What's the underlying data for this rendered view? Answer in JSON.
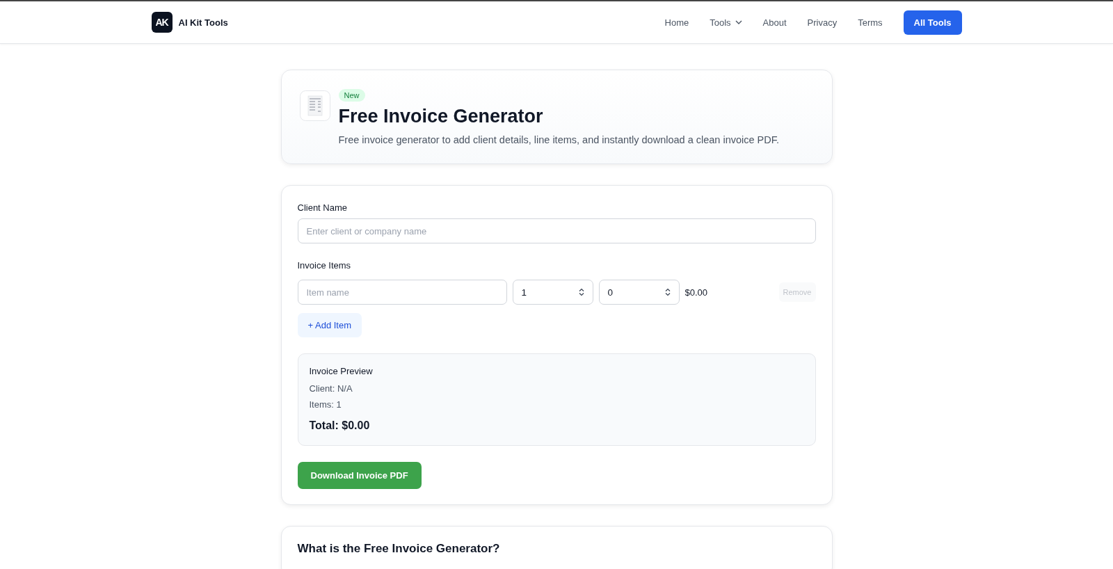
{
  "nav": {
    "brand": "AI Kit Tools",
    "logo_text": "AK",
    "links": [
      {
        "label": "Home",
        "dropdown": false
      },
      {
        "label": "Tools",
        "dropdown": true
      },
      {
        "label": "About",
        "dropdown": false
      },
      {
        "label": "Privacy",
        "dropdown": false
      },
      {
        "label": "Terms",
        "dropdown": false
      }
    ],
    "cta": "All Tools"
  },
  "hero": {
    "badge": "New",
    "title": "Free Invoice Generator",
    "description": "Free invoice generator to add client details, line items, and instantly download a clean invoice PDF."
  },
  "form": {
    "client_label": "Client Name",
    "client_placeholder": "Enter client or company name",
    "items_label": "Invoice Items",
    "items": [
      {
        "name_placeholder": "Item name",
        "quantity": "1",
        "price": "0",
        "amount": "$0.00",
        "remove": "Remove",
        "remove_disabled": true
      }
    ],
    "add_button": "+ Add Item",
    "preview": {
      "title": "Invoice Preview",
      "client": "Client: N/A",
      "items": "Items: 1",
      "total": "Total: $0.00"
    },
    "download_button": "Download Invoice PDF"
  },
  "faq": {
    "heading": "What is the Free Invoice Generator?"
  }
}
